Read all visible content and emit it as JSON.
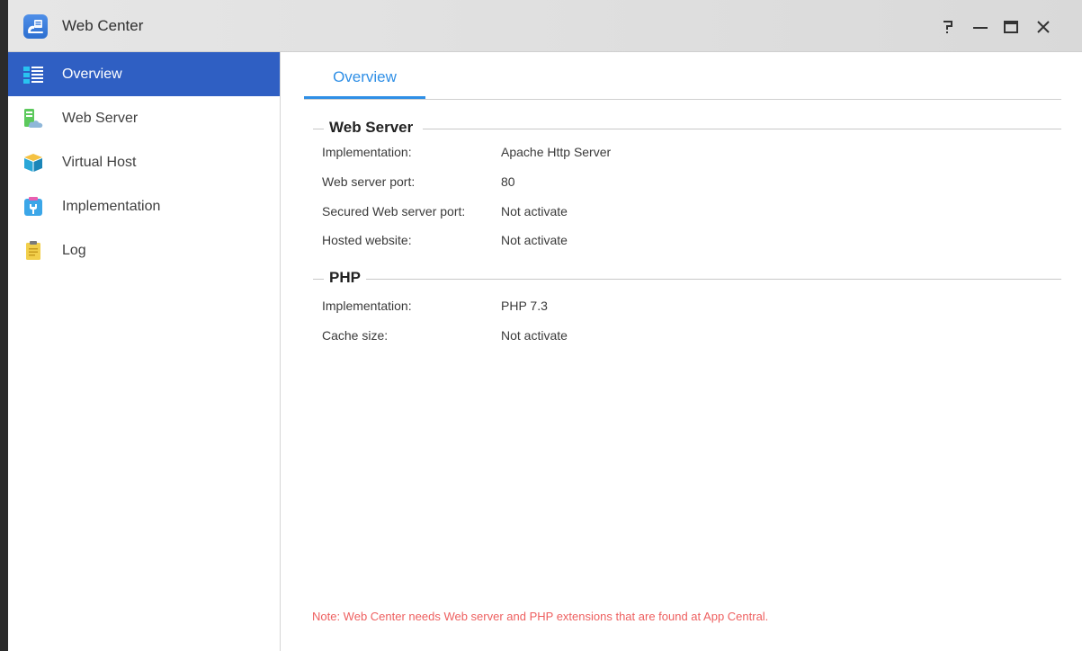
{
  "window": {
    "title": "Web Center",
    "controls": {
      "help_icon": "question-mark",
      "minimize_icon": "minus",
      "maximize_icon": "square",
      "close_icon": "x"
    }
  },
  "sidebar": {
    "items": [
      {
        "label": "Overview",
        "icon": "overview-icon",
        "active": true
      },
      {
        "label": "Web Server",
        "icon": "web-server-icon",
        "active": false
      },
      {
        "label": "Virtual Host",
        "icon": "virtual-host-icon",
        "active": false
      },
      {
        "label": "Implementation",
        "icon": "implementation-icon",
        "active": false
      },
      {
        "label": "Log",
        "icon": "log-icon",
        "active": false
      }
    ]
  },
  "main": {
    "tabs": [
      {
        "label": "Overview",
        "active": true
      }
    ],
    "sections": [
      {
        "title": "Web Server",
        "rows": [
          {
            "label": "Implementation:",
            "value": "Apache Http Server"
          },
          {
            "label": "Web server port:",
            "value": "80"
          },
          {
            "label": "Secured Web server port:",
            "value": "Not activate"
          },
          {
            "label": "Hosted website:",
            "value": "Not activate"
          }
        ]
      },
      {
        "title": "PHP",
        "rows": [
          {
            "label": "Implementation:",
            "value": "PHP 7.3"
          },
          {
            "label": "Cache size:",
            "value": "Not activate"
          }
        ]
      }
    ],
    "note": "Note: Web Center needs Web server and PHP extensions that are found at App Central."
  },
  "colors": {
    "accent": "#2f5fc3",
    "tab_accent": "#2f8fe6",
    "note": "#ee5f5f"
  }
}
